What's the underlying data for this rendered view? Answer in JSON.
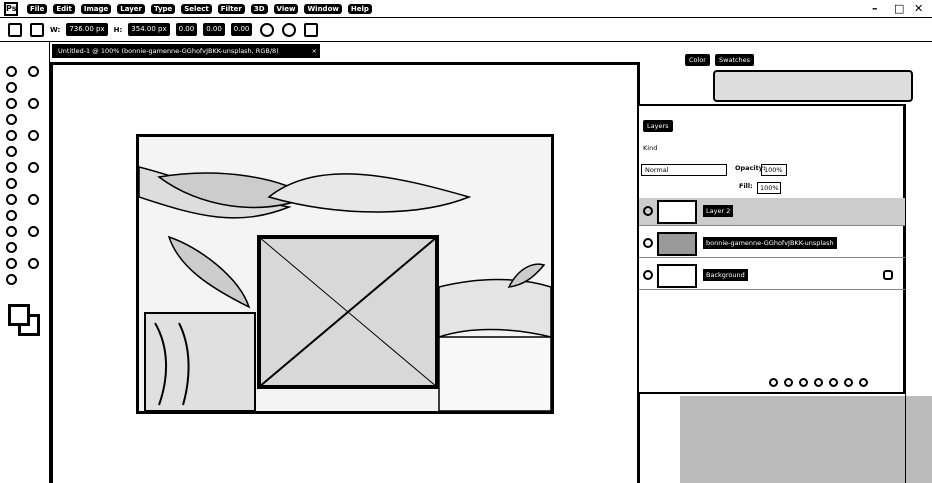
{
  "menubar": {
    "logo": "Ps",
    "items": [
      "File",
      "Edit",
      "Image",
      "Layer",
      "Type",
      "Select",
      "Filter",
      "3D",
      "View",
      "Window",
      "Help"
    ],
    "controls": [
      "–",
      "□",
      "✕"
    ]
  },
  "options": {
    "width_label": "W:",
    "width_value": "736.00 px",
    "height_label": "H:",
    "height_value": "354.00 px",
    "rotate_value": "0.00",
    "h_skew": "0.00",
    "v_skew": "0.00"
  },
  "document": {
    "tab_title": "Untitled-1 @ 100% (bonnie-gamenne-GGhofvJBKK-unsplash, RGB/8)",
    "close": "×"
  },
  "panels": {
    "color_tab": "Color",
    "swatches_tab": "Swatches",
    "layers_tab": "Layers",
    "kind_label": "Kind",
    "blend_mode": "Normal",
    "opacity_label": "Opacity:",
    "opacity_value": "100%",
    "fill_label": "Fill:",
    "fill_value": "100%"
  },
  "layers": [
    {
      "name": "Layer 2",
      "selected": true
    },
    {
      "name": "bonnie-gamenne-GGhofvJBKK-unsplash",
      "selected": false
    },
    {
      "name": "Background",
      "locked": true,
      "selected": false
    }
  ],
  "colors": {
    "ink": "#000000",
    "paper": "#ffffff",
    "panel_grey": "#bbbbbb"
  }
}
